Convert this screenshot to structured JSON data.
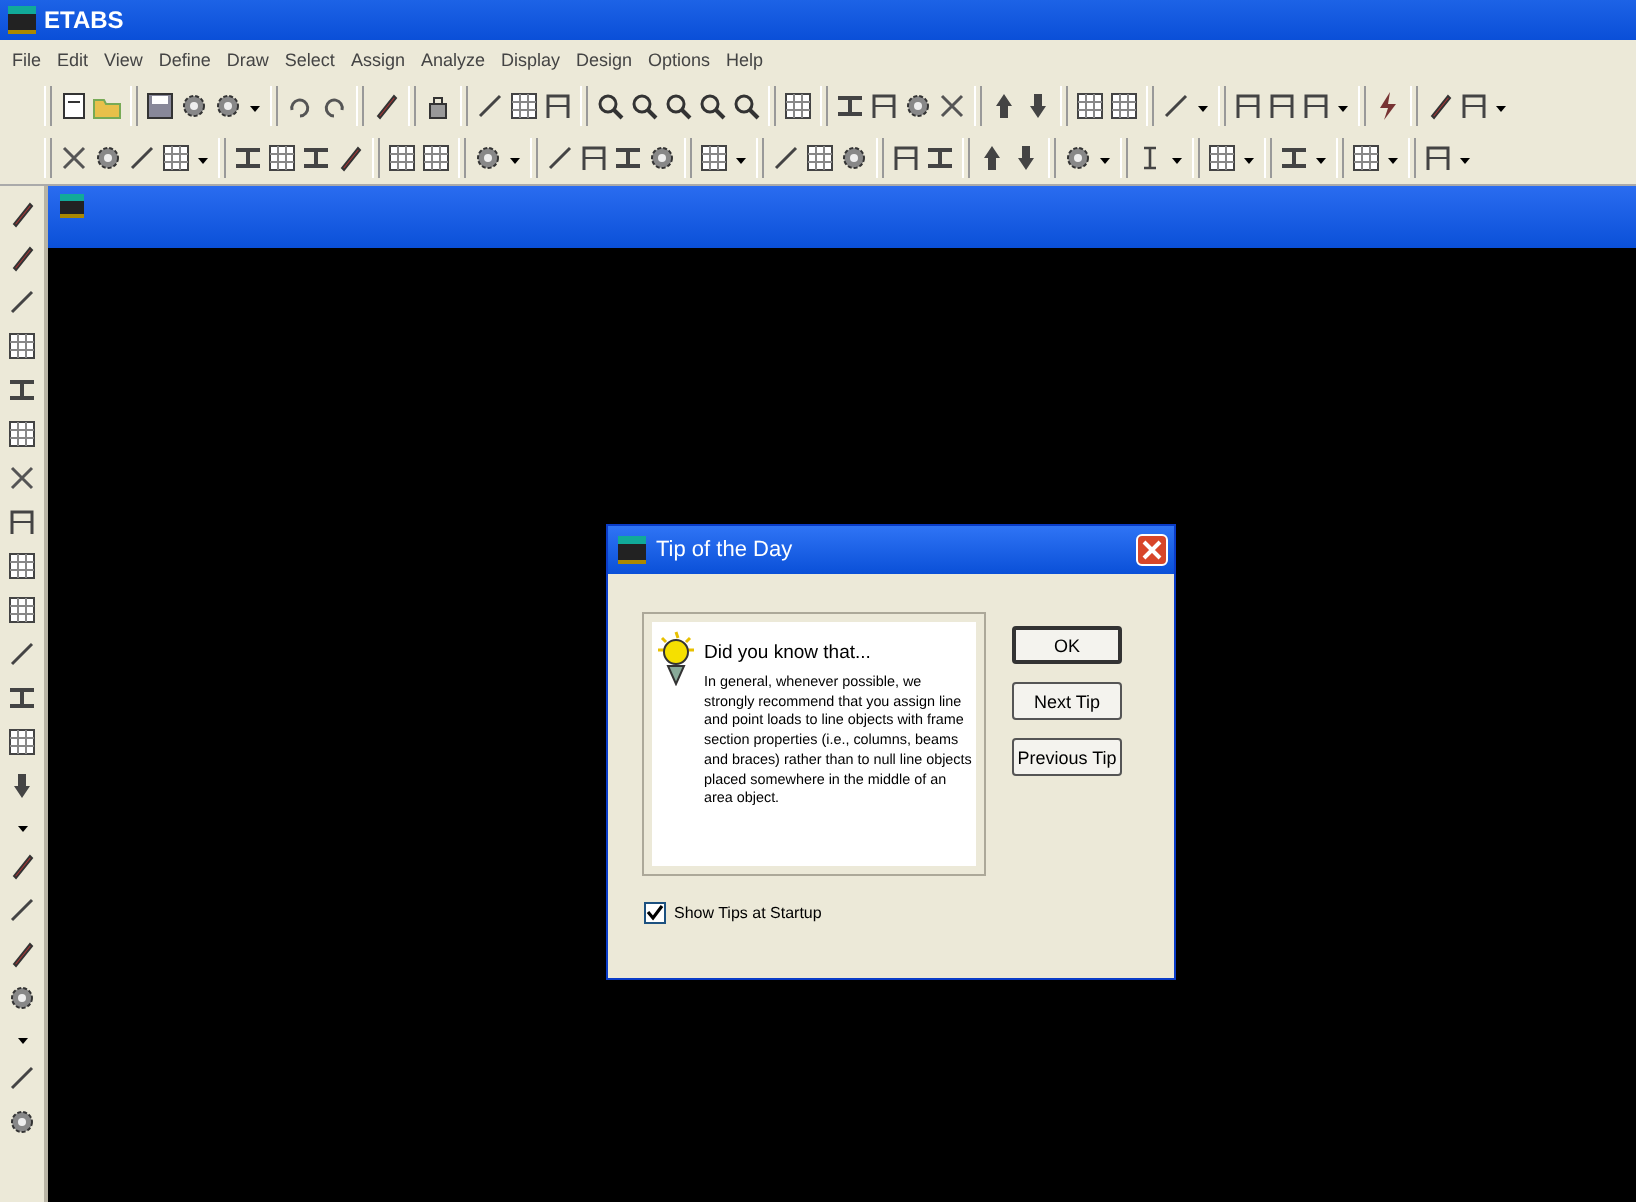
{
  "window": {
    "title": "ETABS"
  },
  "menu": [
    "File",
    "Edit",
    "View",
    "Define",
    "Draw",
    "Select",
    "Assign",
    "Analyze",
    "Display",
    "Design",
    "Options",
    "Help"
  ],
  "dialog": {
    "title": "Tip of the Day",
    "heading": "Did you know that...",
    "tip": "In general, whenever possible, we strongly recommend that you assign line and point loads to line objects with frame section properties (i.e., columns, beams and braces) rather than to null line objects placed somewhere in the middle of an area object.",
    "buttons": [
      "OK",
      "Next Tip",
      "Previous Tip"
    ],
    "checkbox": {
      "label": "Show Tips at Startup",
      "checked": true
    }
  }
}
